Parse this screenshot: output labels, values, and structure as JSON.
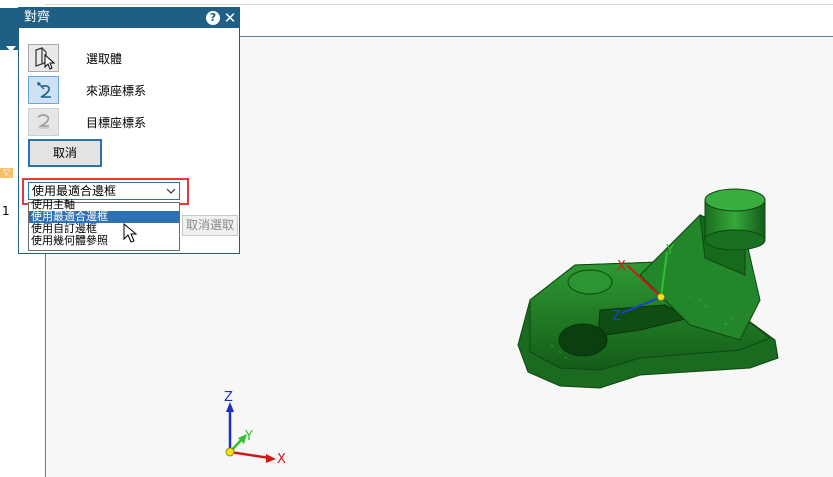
{
  "dialog": {
    "title": "對齊",
    "help_symbol": "?",
    "close_symbol": "✕",
    "rows": [
      {
        "label": "選取體",
        "icon": "select-body-icon",
        "state": "normal"
      },
      {
        "label": "來源座標系",
        "icon": "source-csys-icon",
        "state": "active"
      },
      {
        "label": "目標座標系",
        "icon": "target-csys-icon",
        "state": "disabled"
      }
    ],
    "cancel_label": "取消",
    "bbox_select": {
      "value": "使用最適合邊框",
      "options": [
        "使用主軸",
        "使用最適合邊框",
        "使用自訂邊框",
        "使用幾何體參照"
      ],
      "highlighted_index": 1
    },
    "deselect_label": "取消選取"
  },
  "side": {
    "row_number": "1"
  },
  "triad_small": {
    "x": "X",
    "y": "Y",
    "z": "Z"
  },
  "triad_model": {
    "x": "X",
    "y": "Y",
    "z": "Z"
  },
  "colors": {
    "title_bar": "#1f5f86",
    "highlight_box": "#e23b3b",
    "selected_option": "#2f6fb3",
    "model_green": "#1f7a24"
  }
}
